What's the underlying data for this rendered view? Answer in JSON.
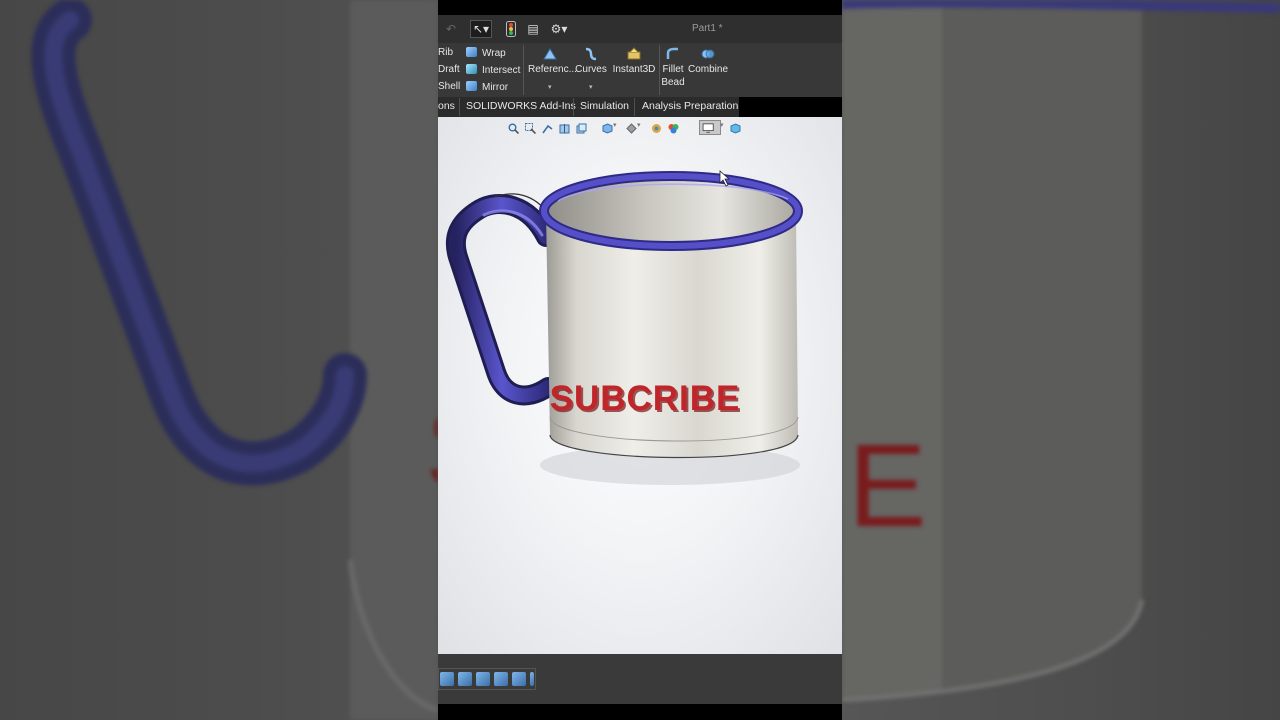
{
  "toolbar": {
    "document_title": "Part1 *",
    "icons": [
      "undo-icon",
      "select-arrow-icon",
      "traffic-light-icon",
      "file-list-icon",
      "gear-icon"
    ]
  },
  "ribbon": {
    "features_col1": [
      "Rib",
      "Draft",
      "Shell"
    ],
    "features_col2": [
      "Wrap",
      "Intersect",
      "Mirror"
    ],
    "reference_label": "Referenc...",
    "curves_label": "Curves",
    "instant3d_label": "Instant3D",
    "fillet_label_line1": "Fillet",
    "fillet_label_line2": "Bead",
    "combine_label": "Combine"
  },
  "tabs": {
    "partial": "ons",
    "addins": "SOLIDWORKS Add-Ins",
    "simulation": "Simulation",
    "analysis": "Analysis Preparation"
  },
  "model": {
    "embossed_text": "SUBCRIBE",
    "text_color": "#c0252a",
    "rim_color": "#4b46b8",
    "handle_color": "#4742b0",
    "body_color": "#e8e6df"
  },
  "background_left_icons": [
    "blurred-mug-handle"
  ],
  "background_right_text": "E"
}
